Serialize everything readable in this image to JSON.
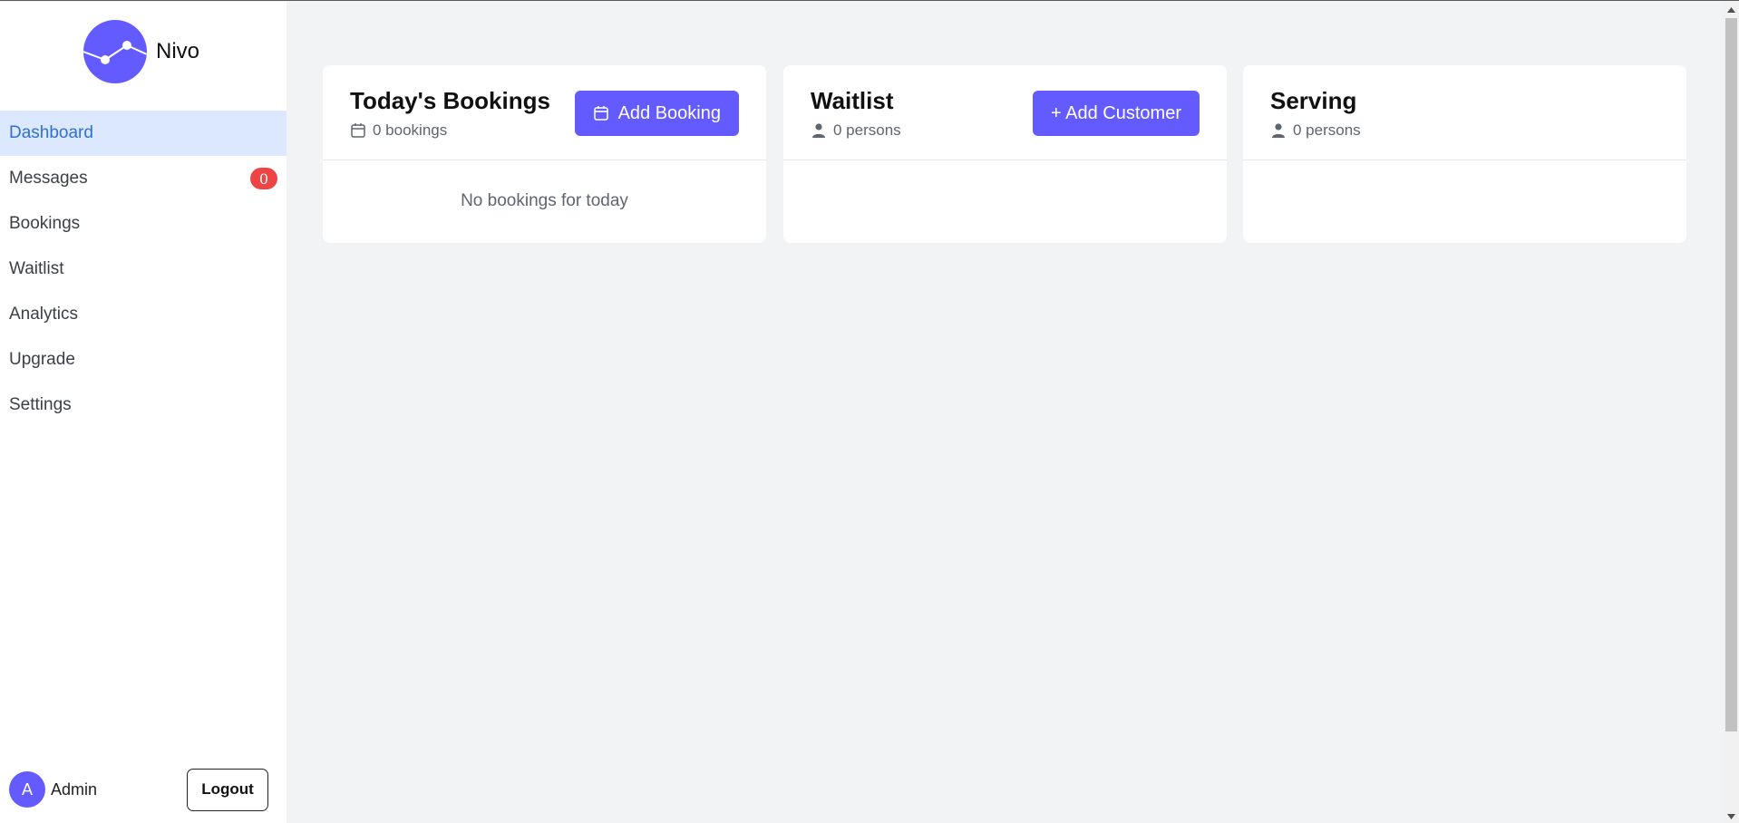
{
  "brand": {
    "name": "Nivo",
    "logo": "line-chart-logo"
  },
  "sidebar": {
    "items": [
      {
        "label": "Dashboard",
        "active": true
      },
      {
        "label": "Messages",
        "badge": "0"
      },
      {
        "label": "Bookings"
      },
      {
        "label": "Waitlist"
      },
      {
        "label": "Analytics"
      },
      {
        "label": "Upgrade"
      },
      {
        "label": "Settings"
      }
    ],
    "user": {
      "initial": "A",
      "name": "Admin",
      "logout_label": "Logout"
    }
  },
  "cards": {
    "bookings": {
      "title": "Today's Bookings",
      "count_text": "0 bookings",
      "icon": "calendar-icon",
      "button_label": "Add Booking",
      "empty_text": "No bookings for today"
    },
    "waitlist": {
      "title": "Waitlist",
      "count_text": "0 persons",
      "icon": "person-icon",
      "button_label": "+ Add Customer"
    },
    "serving": {
      "title": "Serving",
      "count_text": "0 persons",
      "icon": "person-icon"
    }
  },
  "colors": {
    "accent": "#635bff",
    "active_bg": "#dbe8fe",
    "active_text": "#2f6fd8",
    "badge": "#ef4444"
  }
}
